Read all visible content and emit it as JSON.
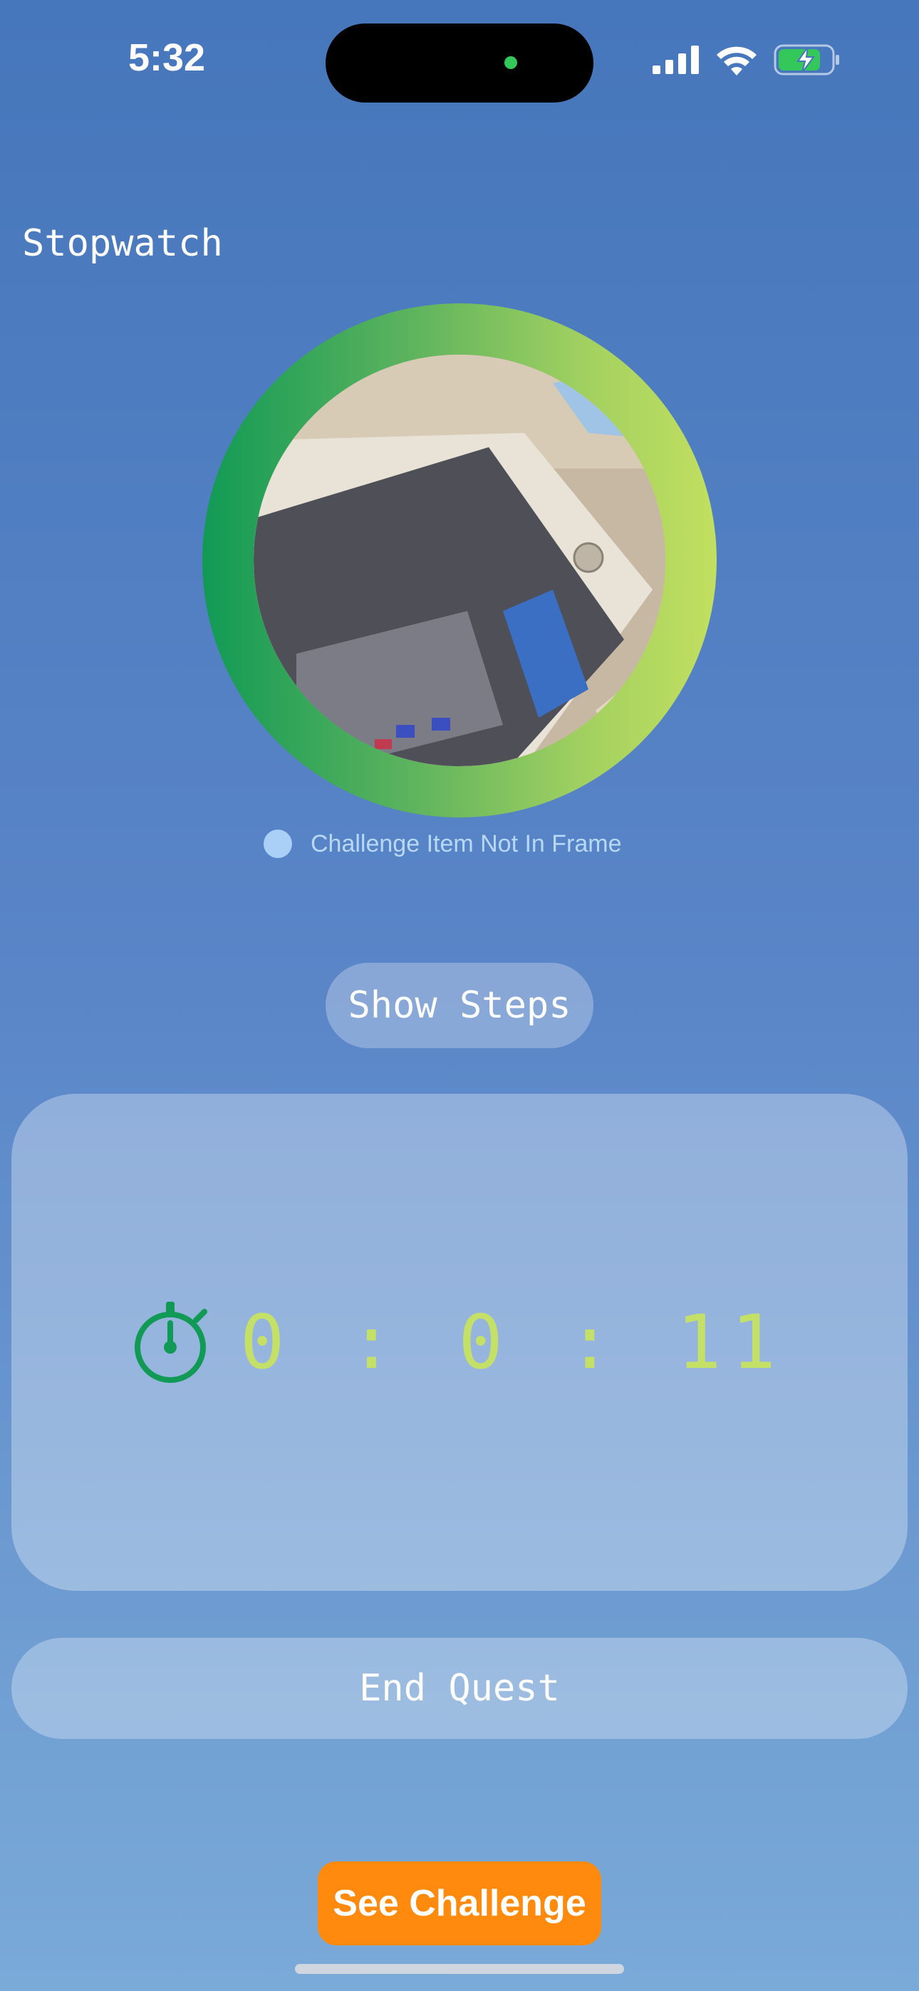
{
  "status_bar": {
    "time": "5:32",
    "icons": [
      "cellular-signal-icon",
      "wifi-icon",
      "battery-charging-icon"
    ],
    "camera_indicator_color": "#34c759"
  },
  "header": {
    "title": "Stopwatch"
  },
  "camera": {
    "ring_colors": [
      "#119a55",
      "#c2df60"
    ]
  },
  "frame_status": {
    "label": "Challenge Item Not In Frame",
    "dot_color": "#aad0f8"
  },
  "steps_button": {
    "label": "Show Steps"
  },
  "timer": {
    "icon": "stopwatch-icon",
    "icon_color": "#119a55",
    "hours": "0",
    "minutes": "0",
    "seconds": "11",
    "display": "0 : 0 : 11",
    "text_color": "#c5e066"
  },
  "end_button": {
    "label": "End Quest"
  },
  "challenge_button": {
    "label": "See Challenge",
    "color": "#ff8a0d"
  }
}
